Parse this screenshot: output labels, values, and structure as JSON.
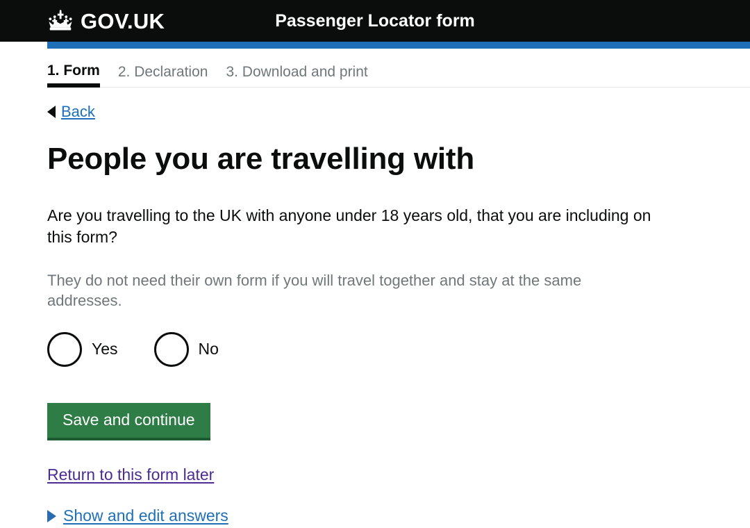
{
  "header": {
    "crown_icon": "crown-icon",
    "brand": "GOV.UK",
    "service_title": "Passenger Locator form",
    "accent_color": "#1d70b8",
    "background_color": "#0b0c0c"
  },
  "tabs": [
    {
      "label": "1. Form",
      "active": true
    },
    {
      "label": "2. Declaration",
      "active": false
    },
    {
      "label": "3. Download and print",
      "active": false
    }
  ],
  "back": {
    "icon": "triangle-left-icon",
    "label": "Back"
  },
  "main": {
    "heading": "People you are travelling with",
    "question": "Are you travelling to the UK with anyone under 18 years old, that you are including on this form?",
    "hint": "They do not need their own form if you will travel together and stay at the same addresses.",
    "radios": [
      {
        "label": "Yes",
        "value": "yes",
        "selected": false
      },
      {
        "label": "No",
        "value": "no",
        "selected": false
      }
    ],
    "submit_label": "Save and continue",
    "submit_color": "#2e7d46",
    "return_link": "Return to this form later",
    "return_link_color": "#4c2c92",
    "disclosure_icon": "triangle-right-icon",
    "disclosure_label": "Show and edit answers",
    "link_color": "#1d70b8"
  }
}
